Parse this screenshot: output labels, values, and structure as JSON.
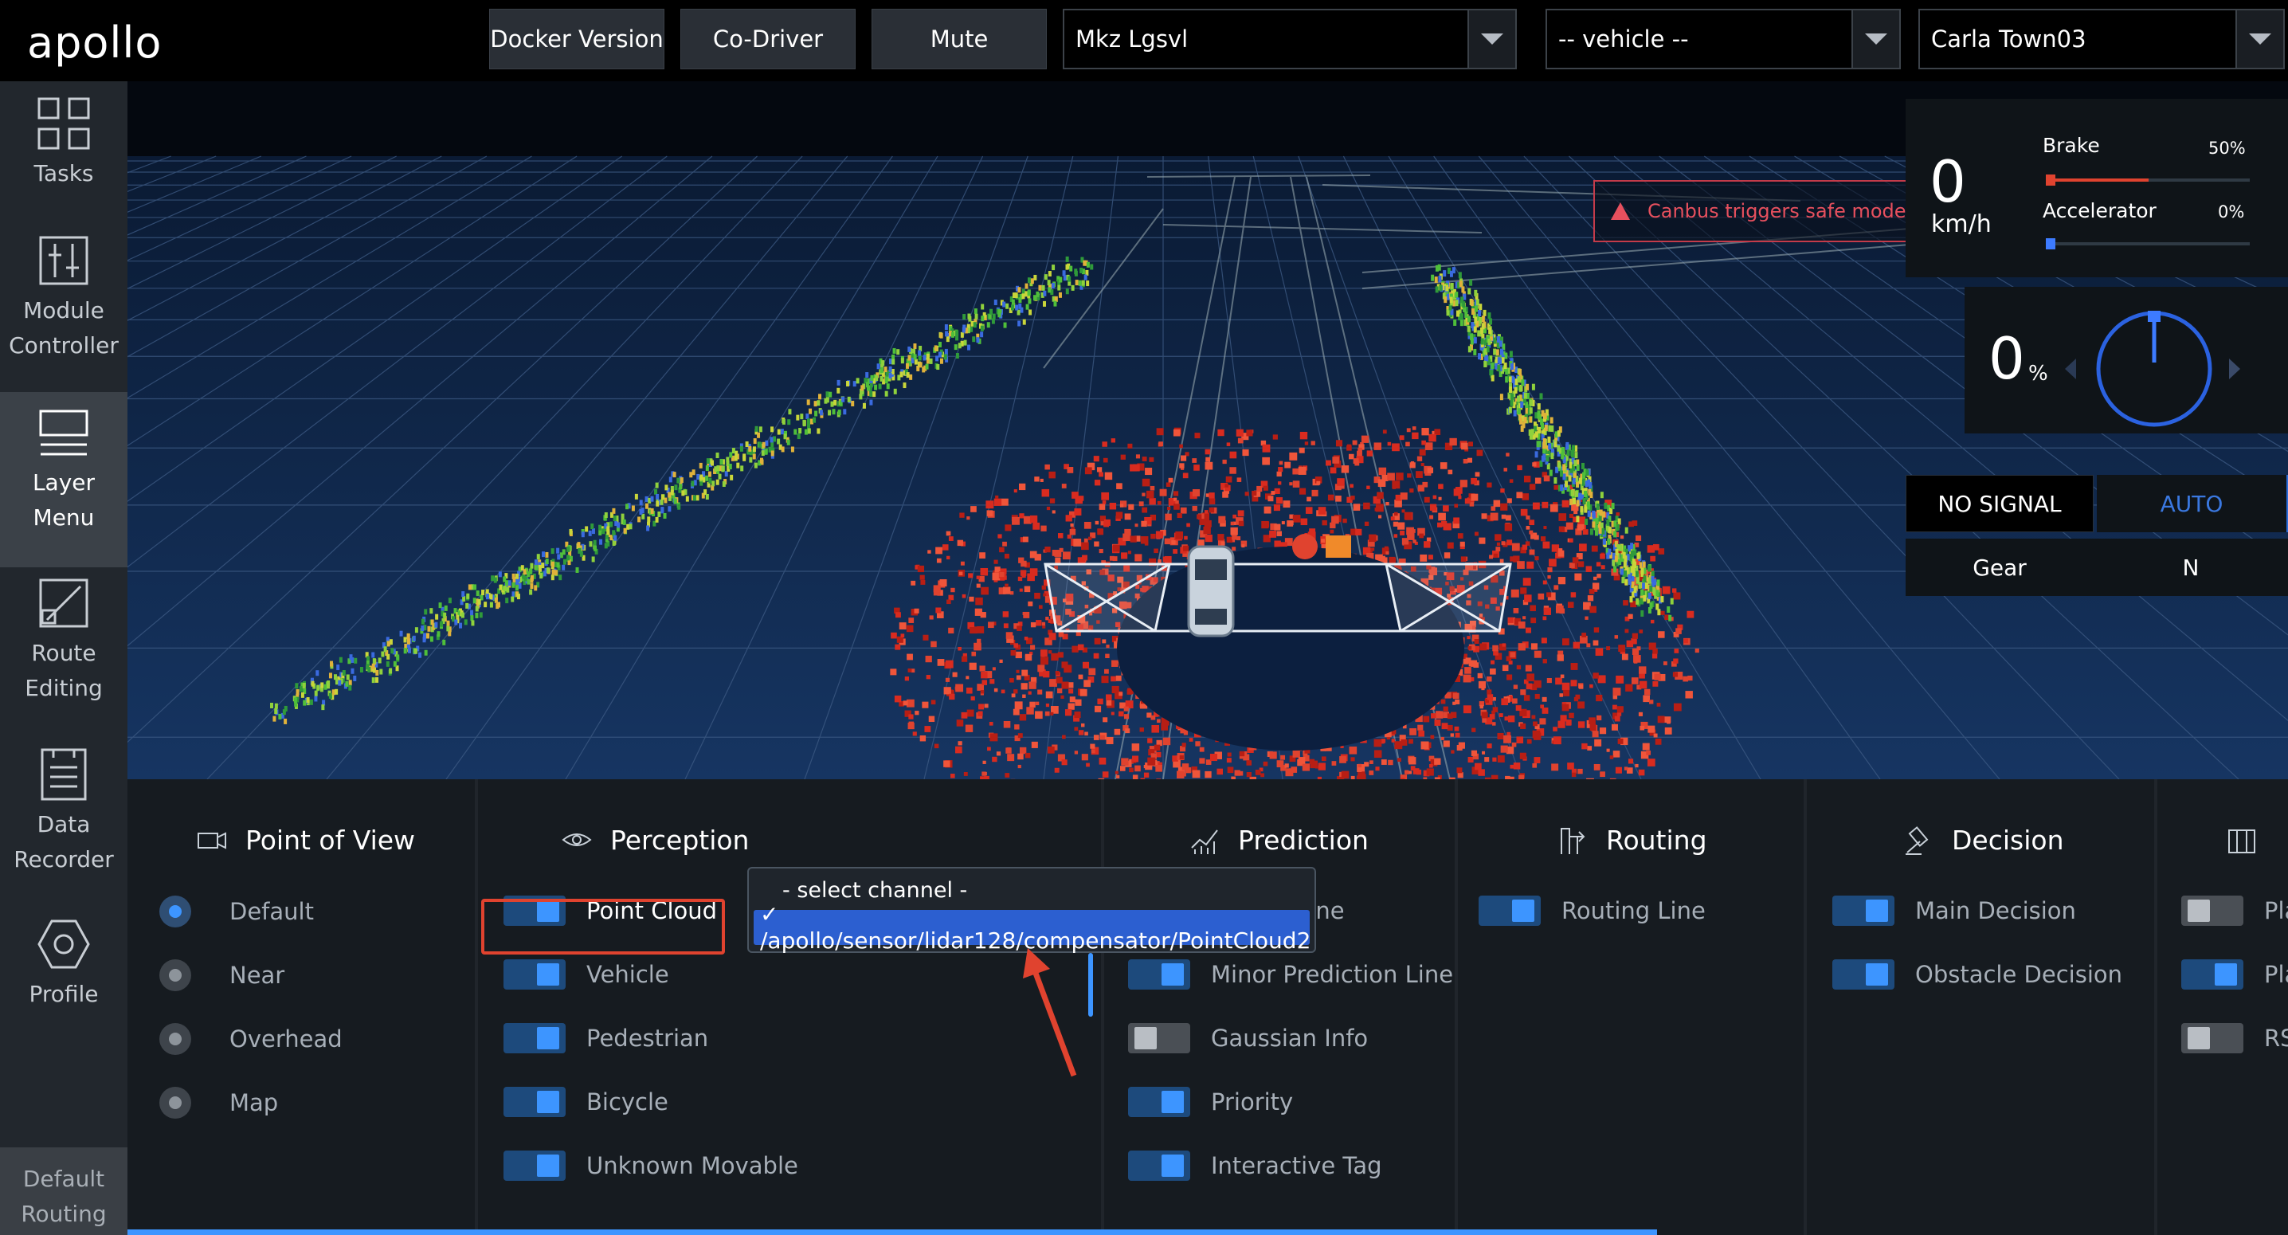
{
  "app": {
    "logo": "apollo"
  },
  "topbar": {
    "docker_button": "Docker Version",
    "codriver_button": "Co-Driver",
    "mute_button": "Mute",
    "vehicle_select": "Mkz Lgsvl",
    "vehicle_select2": "-- vehicle --",
    "map_select": "Carla Town03"
  },
  "sidebar": {
    "items": [
      {
        "label": "Tasks",
        "icon": "grid-icon"
      },
      {
        "label": "Module Controller",
        "icon": "sliders-icon"
      },
      {
        "label": "Layer Menu",
        "icon": "layers-icon"
      },
      {
        "label": "Route Editing",
        "icon": "route-edit-icon"
      },
      {
        "label": "Data Recorder",
        "icon": "recorder-icon"
      },
      {
        "label": "Profile",
        "icon": "hexagon-icon"
      }
    ],
    "active": "Layer Menu",
    "bottom_button": "Default Routing"
  },
  "alert": {
    "text": "Canbus triggers safe mode:"
  },
  "dashboard": {
    "speed": "0",
    "speed_unit": "km/h",
    "brake_label": "Brake",
    "brake_pct": "50%",
    "brake_value": 0.5,
    "accel_label": "Accelerator",
    "accel_pct": "0%",
    "accel_value": 0,
    "steering": "0",
    "steering_unit": "%",
    "signal": "NO SIGNAL",
    "mode": "AUTO",
    "gear_label": "Gear",
    "gear": "N",
    "colors": {
      "brake": "#e0432f",
      "accel": "#3d7bff",
      "mode": "#3a78e0"
    }
  },
  "layer_menu": {
    "point_of_view": {
      "title": "Point of View",
      "options": [
        "Default",
        "Near",
        "Overhead",
        "Map"
      ],
      "selected": "Default"
    },
    "perception": {
      "title": "Perception",
      "items": [
        {
          "label": "Point Cloud",
          "on": true
        },
        {
          "label": "Vehicle",
          "on": true
        },
        {
          "label": "Pedestrian",
          "on": true
        },
        {
          "label": "Bicycle",
          "on": true
        },
        {
          "label": "Unknown Movable",
          "on": true
        }
      ]
    },
    "channel_dropdown": {
      "placeholder": "- select channel -",
      "selected": "✓ /apollo/sensor/lidar128/compensator/PointCloud2"
    },
    "prediction": {
      "title": "Prediction",
      "items": [
        {
          "label": "diction Line",
          "on": true
        },
        {
          "label": "Minor Prediction Line",
          "on": true
        },
        {
          "label": "Gaussian Info",
          "on": false
        },
        {
          "label": "Priority",
          "on": true
        },
        {
          "label": "Interactive Tag",
          "on": true
        }
      ]
    },
    "routing": {
      "title": "Routing",
      "items": [
        {
          "label": "Routing Line",
          "on": true
        }
      ]
    },
    "decision": {
      "title": "Decision",
      "items": [
        {
          "label": "Main Decision",
          "on": true
        },
        {
          "label": "Obstacle Decision",
          "on": true
        }
      ]
    },
    "planning": {
      "items": [
        {
          "label": "Pla",
          "on": false
        },
        {
          "label": "Pla",
          "on": true
        },
        {
          "label": "RS",
          "on": false
        }
      ]
    }
  }
}
